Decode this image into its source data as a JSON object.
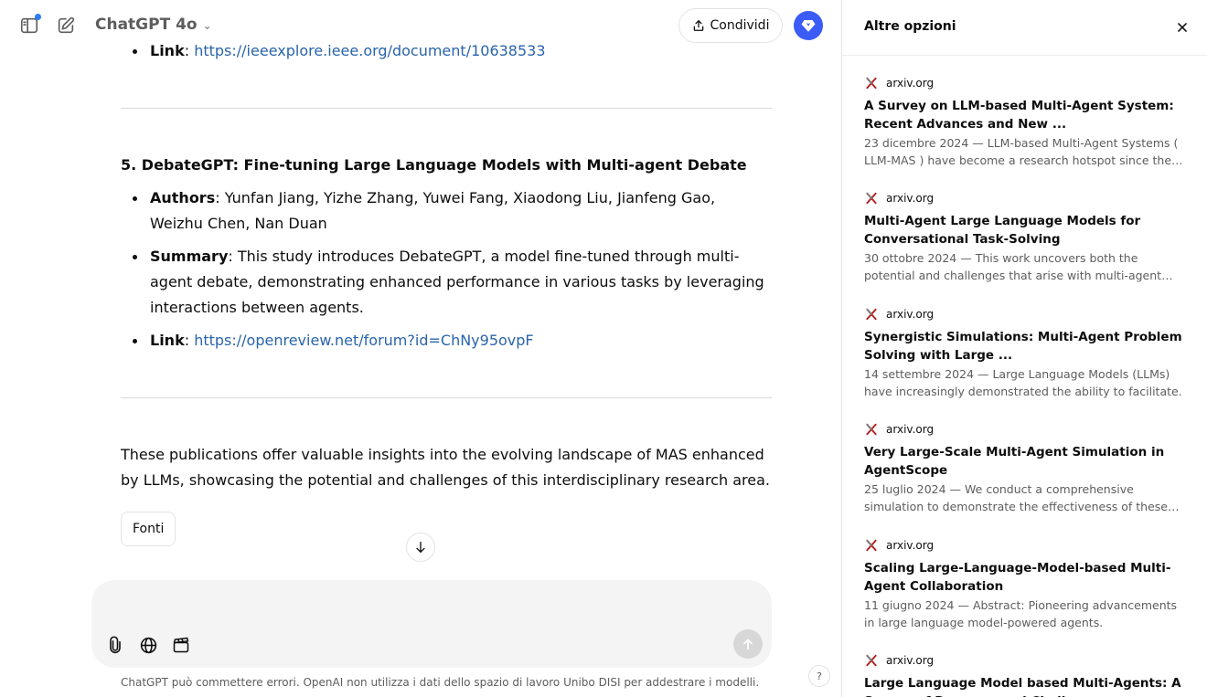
{
  "topbar": {
    "model_name": "ChatGPT 4o",
    "share_label": "Condividi"
  },
  "message": {
    "prev_link_label": "Link",
    "prev_link_url": "https://ieeexplore.ieee.org/document/10638533",
    "pub5": {
      "heading": "5. DebateGPT: Fine-tuning Large Language Models with Multi-agent Debate",
      "authors_label": "Authors",
      "authors": "Yunfan Jiang, Yizhe Zhang, Yuwei Fang, Xiaodong Liu, Jianfeng Gao, Weizhu Chen, Nan Duan",
      "summary_label": "Summary",
      "summary": "This study introduces DebateGPT, a model fine-tuned through multi-agent debate, demonstrating enhanced performance in various tasks by leveraging interactions between agents.",
      "link_label": "Link",
      "link_url": "https://openreview.net/forum?id=ChNy95ovpF"
    },
    "conclusion": "These publications offer valuable insights into the evolving landscape of MAS enhanced by LLMs, showcasing the potential and challenges of this interdisciplinary research area.",
    "sources_button": "Fonti"
  },
  "footer": {
    "disclaimer": "ChatGPT può commettere errori. OpenAI non utilizza i dati dello spazio di lavoro Unibo DISI per addestrare i modelli.",
    "help": "?"
  },
  "panel": {
    "title": "Altre opzioni",
    "sources": [
      {
        "site": "arxiv.org",
        "title": "A Survey on LLM-based Multi-Agent System: Recent Advances and New ...",
        "snippet": "23 dicembre 2024 — LLM-based Multi-Agent Systems ( LLM-MAS ) have become a research hotspot since the rise of LLMs."
      },
      {
        "site": "arxiv.org",
        "title": "Multi-Agent Large Language Models for Conversational Task-Solving",
        "snippet": "30 ottobre 2024 — This work uncovers both the potential and challenges that arise with multi-agent systems."
      },
      {
        "site": "arxiv.org",
        "title": "Synergistic Simulations: Multi-Agent Problem Solving with Large ...",
        "snippet": "14 settembre 2024 — Large Language Models (LLMs) have increasingly demonstrated the ability to facilitate."
      },
      {
        "site": "arxiv.org",
        "title": "Very Large-Scale Multi-Agent Simulation in AgentScope",
        "snippet": "25 luglio 2024 — We conduct a comprehensive simulation to demonstrate the effectiveness of these improvements."
      },
      {
        "site": "arxiv.org",
        "title": "Scaling Large-Language-Model-based Multi-Agent Collaboration",
        "snippet": "11 giugno 2024 — Abstract: Pioneering advancements in large language model-powered agents."
      },
      {
        "site": "arxiv.org",
        "title": "Large Language Model based Multi-Agents: A Survey of Progress and Challenges",
        "snippet": ""
      }
    ]
  },
  "colors": {
    "link": "#2964aa",
    "avatar": "#3b5cf6",
    "notification_dot": "#2a7cf6",
    "favicon": "#b31b1b"
  }
}
